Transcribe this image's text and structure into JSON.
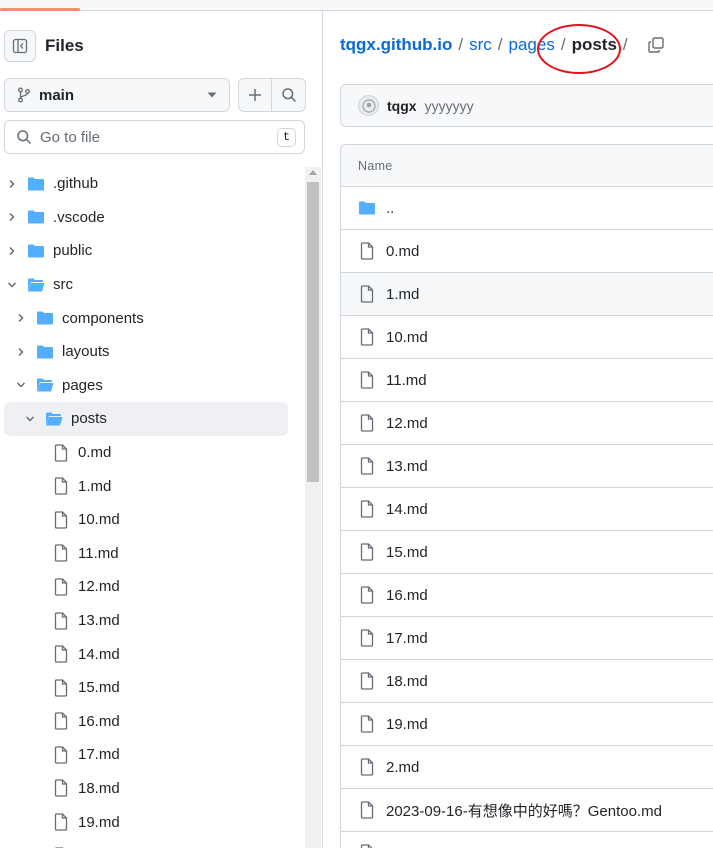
{
  "sidebar": {
    "title": "Files",
    "branch": "main",
    "search_placeholder": "Go to file",
    "search_shortcut": "t",
    "tree": [
      {
        "label": ".github",
        "type": "dir",
        "depth": 0,
        "expanded": false
      },
      {
        "label": ".vscode",
        "type": "dir",
        "depth": 0,
        "expanded": false
      },
      {
        "label": "public",
        "type": "dir",
        "depth": 0,
        "expanded": false
      },
      {
        "label": "src",
        "type": "dir",
        "depth": 0,
        "expanded": true
      },
      {
        "label": "components",
        "type": "dir",
        "depth": 1,
        "expanded": false
      },
      {
        "label": "layouts",
        "type": "dir",
        "depth": 1,
        "expanded": false
      },
      {
        "label": "pages",
        "type": "dir",
        "depth": 1,
        "expanded": true
      },
      {
        "label": "posts",
        "type": "dir",
        "depth": 2,
        "expanded": true,
        "selected": true
      },
      {
        "label": "0.md",
        "type": "file",
        "depth": 3
      },
      {
        "label": "1.md",
        "type": "file",
        "depth": 3
      },
      {
        "label": "10.md",
        "type": "file",
        "depth": 3
      },
      {
        "label": "11.md",
        "type": "file",
        "depth": 3
      },
      {
        "label": "12.md",
        "type": "file",
        "depth": 3
      },
      {
        "label": "13.md",
        "type": "file",
        "depth": 3
      },
      {
        "label": "14.md",
        "type": "file",
        "depth": 3
      },
      {
        "label": "15.md",
        "type": "file",
        "depth": 3
      },
      {
        "label": "16.md",
        "type": "file",
        "depth": 3
      },
      {
        "label": "17.md",
        "type": "file",
        "depth": 3
      },
      {
        "label": "18.md",
        "type": "file",
        "depth": 3
      },
      {
        "label": "19.md",
        "type": "file",
        "depth": 3
      },
      {
        "label": "",
        "type": "file",
        "depth": 3
      }
    ]
  },
  "breadcrumb": {
    "repo": "tqgx.github.io",
    "parts": [
      "src",
      "pages"
    ],
    "current": "posts",
    "trailing_sep": "/"
  },
  "commit": {
    "author": "tqgx",
    "message": "yyyyyyy"
  },
  "table": {
    "header": "Name",
    "rows": [
      {
        "label": "..",
        "type": "dir"
      },
      {
        "label": "0.md",
        "type": "file"
      },
      {
        "label": "1.md",
        "type": "file",
        "hover": true
      },
      {
        "label": "10.md",
        "type": "file"
      },
      {
        "label": "11.md",
        "type": "file"
      },
      {
        "label": "12.md",
        "type": "file"
      },
      {
        "label": "13.md",
        "type": "file"
      },
      {
        "label": "14.md",
        "type": "file"
      },
      {
        "label": "15.md",
        "type": "file"
      },
      {
        "label": "16.md",
        "type": "file"
      },
      {
        "label": "17.md",
        "type": "file"
      },
      {
        "label": "18.md",
        "type": "file"
      },
      {
        "label": "19.md",
        "type": "file"
      },
      {
        "label": "2.md",
        "type": "file"
      },
      {
        "label": "2023-09-16-有想像中的好嗎？Gentoo.md",
        "type": "file"
      },
      {
        "label": "",
        "type": "file"
      }
    ]
  },
  "colors": {
    "link": "#0969da",
    "folder": "#54aeff",
    "annotation_circle": "#e0141e",
    "tab_accent": "#fd8c73"
  },
  "icons": {
    "panel": "sidebar-collapse-icon",
    "branch": "git-branch-icon",
    "caret": "triangle-down-icon",
    "add": "plus-icon",
    "search": "search-icon",
    "folder": "folder-icon",
    "folder_open": "folder-open-icon",
    "file": "file-icon",
    "copy": "copy-icon",
    "chevron_right": "chevron-right-icon",
    "chevron_down": "chevron-down-icon"
  }
}
